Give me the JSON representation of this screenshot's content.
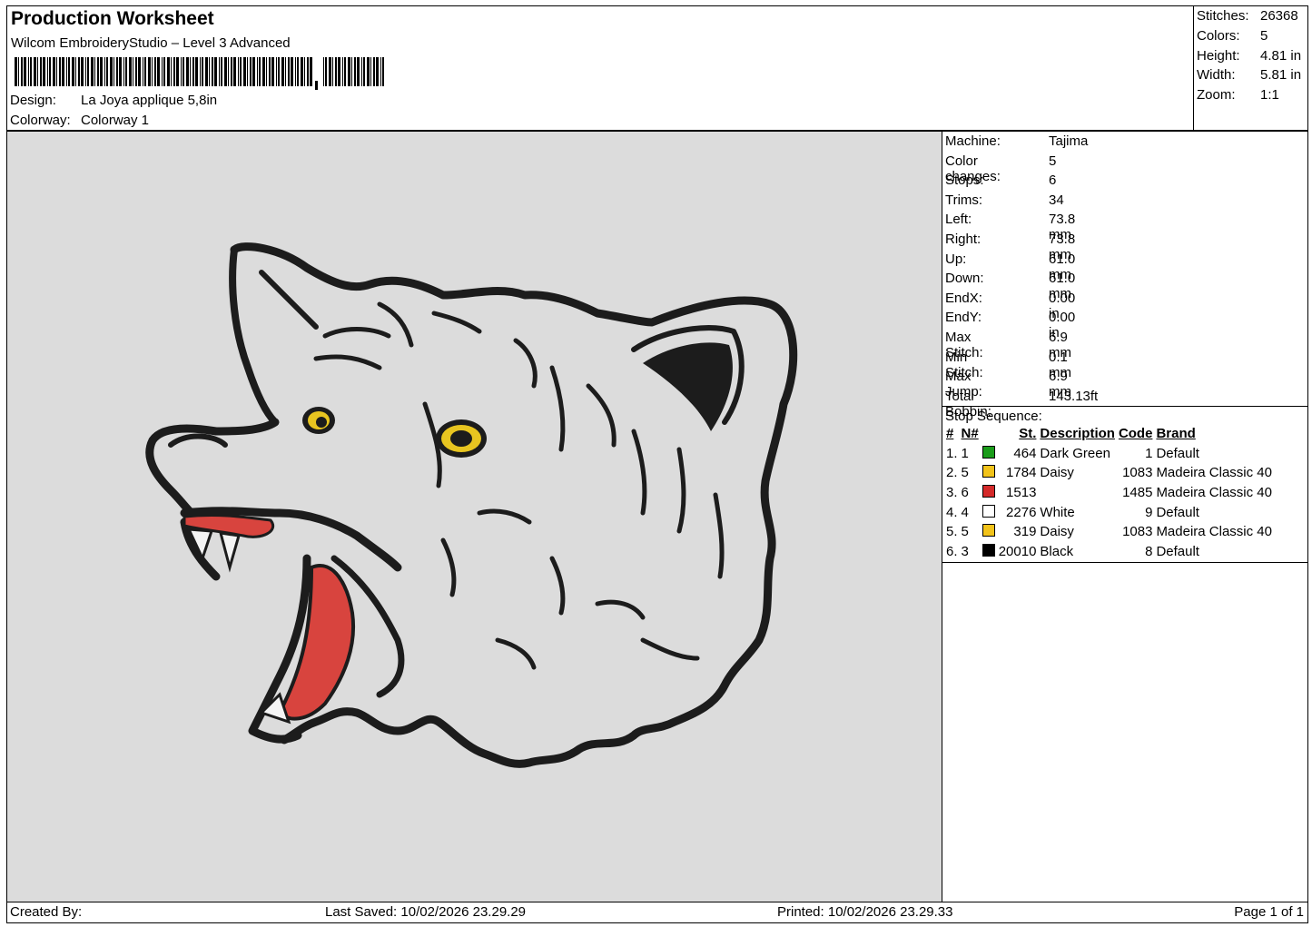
{
  "header": {
    "title": "Production Worksheet",
    "software": "Wilcom EmbroideryStudio – Level 3 Advanced",
    "design_label": "Design:",
    "design_value": "La Joya applique 5,8in",
    "colorway_label": "Colorway:",
    "colorway_value": "Colorway 1"
  },
  "stats": [
    {
      "label": "Stitches:",
      "value": "26368"
    },
    {
      "label": "Colors:",
      "value": "5"
    },
    {
      "label": "Height:",
      "value": "4.81 in"
    },
    {
      "label": "Width:",
      "value": "5.81 in"
    },
    {
      "label": "Zoom:",
      "value": "1:1"
    }
  ],
  "machine_info": [
    {
      "label": "Machine:",
      "value": "Tajima"
    },
    {
      "label": "Color changes:",
      "value": "5"
    },
    {
      "label": "Stops:",
      "value": "6"
    },
    {
      "label": "Trims:",
      "value": "34"
    },
    {
      "label": "Left:",
      "value": "73.8 mm"
    },
    {
      "label": "Right:",
      "value": "73.8 mm"
    },
    {
      "label": "Up:",
      "value": "61.0 mm"
    },
    {
      "label": "Down:",
      "value": "61.0 mm"
    },
    {
      "label": "EndX:",
      "value": "0.00 in"
    },
    {
      "label": "EndY:",
      "value": "0.00 in"
    },
    {
      "label": "Max Stitch:",
      "value": "6.9 mm"
    },
    {
      "label": "Min Stitch:",
      "value": "0.1 mm"
    },
    {
      "label": "Max Jump:",
      "value": "6.9 mm"
    },
    {
      "label": "Total Bobbin:",
      "value": "143.13ft"
    }
  ],
  "stop_sequence": {
    "title": "Stop Sequence:",
    "columns": [
      "#",
      "N#",
      "St.",
      "Description",
      "Code",
      "Brand"
    ],
    "rows": [
      {
        "num": "1.",
        "n": "1",
        "color": "#1a9c1a",
        "st": "464",
        "desc": "Dark Green",
        "code": "1",
        "brand": "Default"
      },
      {
        "num": "2.",
        "n": "5",
        "color": "#f2c31a",
        "st": "1784",
        "desc": "Daisy",
        "code": "1083",
        "brand": "Madeira Classic 40"
      },
      {
        "num": "3.",
        "n": "6",
        "color": "#d42a2a",
        "st": "1513",
        "desc": "",
        "code": "1485",
        "brand": "Madeira Classic 40"
      },
      {
        "num": "4.",
        "n": "4",
        "color": "#ffffff",
        "st": "2276",
        "desc": "White",
        "code": "9",
        "brand": "Default"
      },
      {
        "num": "5.",
        "n": "5",
        "color": "#f2c31a",
        "st": "319",
        "desc": "Daisy",
        "code": "1083",
        "brand": "Madeira Classic 40"
      },
      {
        "num": "6.",
        "n": "3",
        "color": "#000000",
        "st": "20010",
        "desc": "Black",
        "code": "8",
        "brand": "Default"
      }
    ]
  },
  "footer": {
    "created_by": "Created By:",
    "last_saved": "Last Saved: 10/02/2026 23.29.29",
    "printed": "Printed: 10/02/2026 23.29.33",
    "page": "Page 1 of 1"
  },
  "preview": {
    "fabric_color": "#dcdcdc",
    "outline_color": "#1c1c1c",
    "eye_color": "#e8c520",
    "mouth_color": "#d8443e"
  }
}
